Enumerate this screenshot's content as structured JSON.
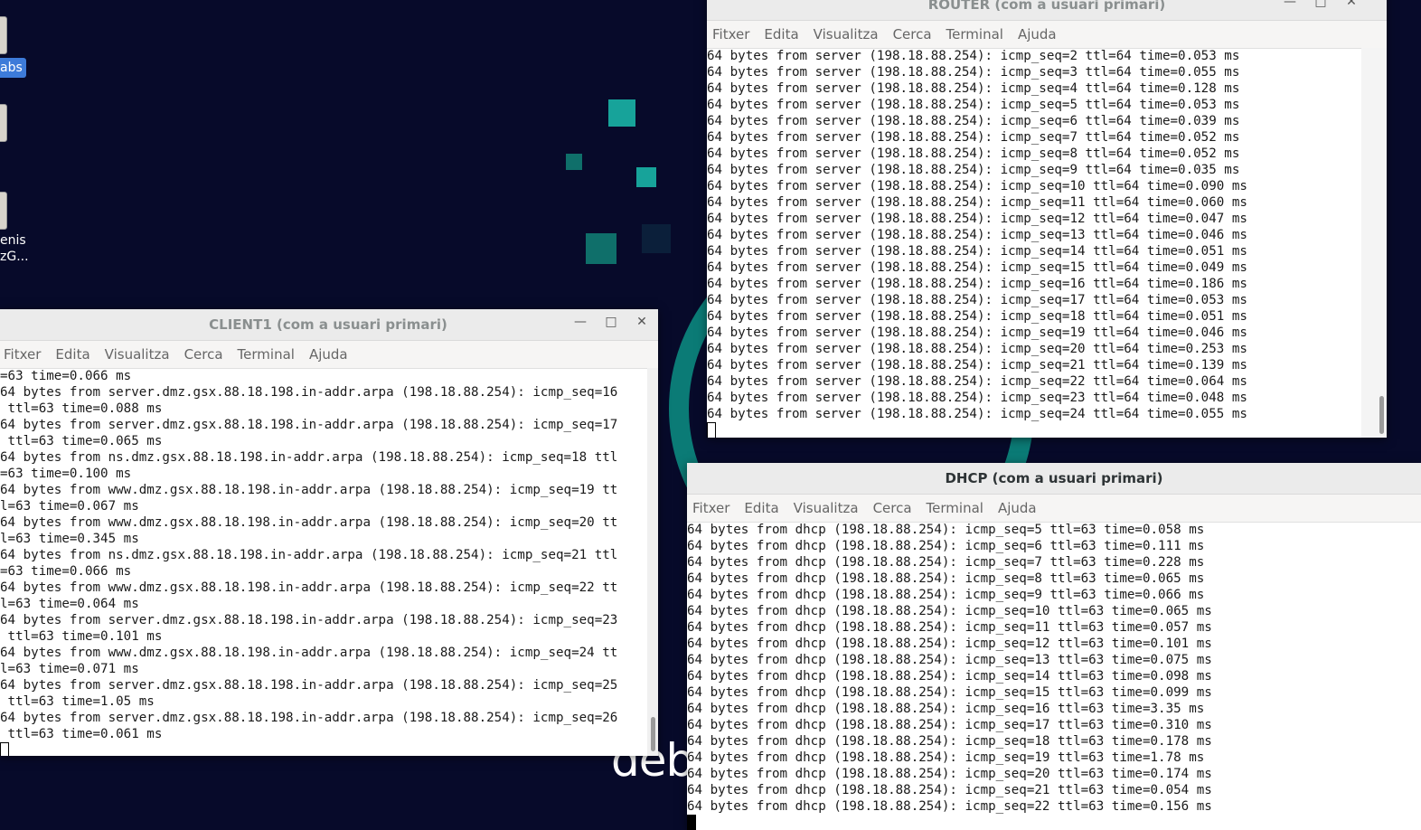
{
  "desktop": {
    "icon_labels": [
      "abs",
      "enis",
      "zG..."
    ],
    "logo": "debian"
  },
  "menu": [
    "Fitxer",
    "Edita",
    "Visualitza",
    "Cerca",
    "Terminal",
    "Ajuda"
  ],
  "router": {
    "title": "ROUTER (com a usuari primari)",
    "lines": [
      "64 bytes from server (198.18.88.254): icmp_seq=2 ttl=64 time=0.053 ms",
      "64 bytes from server (198.18.88.254): icmp_seq=3 ttl=64 time=0.055 ms",
      "64 bytes from server (198.18.88.254): icmp_seq=4 ttl=64 time=0.128 ms",
      "64 bytes from server (198.18.88.254): icmp_seq=5 ttl=64 time=0.053 ms",
      "64 bytes from server (198.18.88.254): icmp_seq=6 ttl=64 time=0.039 ms",
      "64 bytes from server (198.18.88.254): icmp_seq=7 ttl=64 time=0.052 ms",
      "64 bytes from server (198.18.88.254): icmp_seq=8 ttl=64 time=0.052 ms",
      "64 bytes from server (198.18.88.254): icmp_seq=9 ttl=64 time=0.035 ms",
      "64 bytes from server (198.18.88.254): icmp_seq=10 ttl=64 time=0.090 ms",
      "64 bytes from server (198.18.88.254): icmp_seq=11 ttl=64 time=0.060 ms",
      "64 bytes from server (198.18.88.254): icmp_seq=12 ttl=64 time=0.047 ms",
      "64 bytes from server (198.18.88.254): icmp_seq=13 ttl=64 time=0.046 ms",
      "64 bytes from server (198.18.88.254): icmp_seq=14 ttl=64 time=0.051 ms",
      "64 bytes from server (198.18.88.254): icmp_seq=15 ttl=64 time=0.049 ms",
      "64 bytes from server (198.18.88.254): icmp_seq=16 ttl=64 time=0.186 ms",
      "64 bytes from server (198.18.88.254): icmp_seq=17 ttl=64 time=0.053 ms",
      "64 bytes from server (198.18.88.254): icmp_seq=18 ttl=64 time=0.051 ms",
      "64 bytes from server (198.18.88.254): icmp_seq=19 ttl=64 time=0.046 ms",
      "64 bytes from server (198.18.88.254): icmp_seq=20 ttl=64 time=0.253 ms",
      "64 bytes from server (198.18.88.254): icmp_seq=21 ttl=64 time=0.139 ms",
      "64 bytes from server (198.18.88.254): icmp_seq=22 ttl=64 time=0.064 ms",
      "64 bytes from server (198.18.88.254): icmp_seq=23 ttl=64 time=0.048 ms",
      "64 bytes from server (198.18.88.254): icmp_seq=24 ttl=64 time=0.055 ms"
    ]
  },
  "client1": {
    "title": "CLIENT1 (com a usuari primari)",
    "lines": [
      "=63 time=0.066 ms",
      "64 bytes from server.dmz.gsx.88.18.198.in-addr.arpa (198.18.88.254): icmp_seq=16",
      " ttl=63 time=0.088 ms",
      "64 bytes from server.dmz.gsx.88.18.198.in-addr.arpa (198.18.88.254): icmp_seq=17",
      " ttl=63 time=0.065 ms",
      "64 bytes from ns.dmz.gsx.88.18.198.in-addr.arpa (198.18.88.254): icmp_seq=18 ttl",
      "=63 time=0.100 ms",
      "64 bytes from www.dmz.gsx.88.18.198.in-addr.arpa (198.18.88.254): icmp_seq=19 tt",
      "l=63 time=0.067 ms",
      "64 bytes from www.dmz.gsx.88.18.198.in-addr.arpa (198.18.88.254): icmp_seq=20 tt",
      "l=63 time=0.345 ms",
      "64 bytes from ns.dmz.gsx.88.18.198.in-addr.arpa (198.18.88.254): icmp_seq=21 ttl",
      "=63 time=0.066 ms",
      "64 bytes from www.dmz.gsx.88.18.198.in-addr.arpa (198.18.88.254): icmp_seq=22 tt",
      "l=63 time=0.064 ms",
      "64 bytes from server.dmz.gsx.88.18.198.in-addr.arpa (198.18.88.254): icmp_seq=23",
      " ttl=63 time=0.101 ms",
      "64 bytes from www.dmz.gsx.88.18.198.in-addr.arpa (198.18.88.254): icmp_seq=24 tt",
      "l=63 time=0.071 ms",
      "64 bytes from server.dmz.gsx.88.18.198.in-addr.arpa (198.18.88.254): icmp_seq=25",
      " ttl=63 time=1.05 ms",
      "64 bytes from server.dmz.gsx.88.18.198.in-addr.arpa (198.18.88.254): icmp_seq=26",
      " ttl=63 time=0.061 ms"
    ]
  },
  "dhcp": {
    "title": "DHCP (com a usuari primari)",
    "lines": [
      "64 bytes from dhcp (198.18.88.254): icmp_seq=5 ttl=63 time=0.058 ms",
      "64 bytes from dhcp (198.18.88.254): icmp_seq=6 ttl=63 time=0.111 ms",
      "64 bytes from dhcp (198.18.88.254): icmp_seq=7 ttl=63 time=0.228 ms",
      "64 bytes from dhcp (198.18.88.254): icmp_seq=8 ttl=63 time=0.065 ms",
      "64 bytes from dhcp (198.18.88.254): icmp_seq=9 ttl=63 time=0.066 ms",
      "64 bytes from dhcp (198.18.88.254): icmp_seq=10 ttl=63 time=0.065 ms",
      "64 bytes from dhcp (198.18.88.254): icmp_seq=11 ttl=63 time=0.057 ms",
      "64 bytes from dhcp (198.18.88.254): icmp_seq=12 ttl=63 time=0.101 ms",
      "64 bytes from dhcp (198.18.88.254): icmp_seq=13 ttl=63 time=0.075 ms",
      "64 bytes from dhcp (198.18.88.254): icmp_seq=14 ttl=63 time=0.098 ms",
      "64 bytes from dhcp (198.18.88.254): icmp_seq=15 ttl=63 time=0.099 ms",
      "64 bytes from dhcp (198.18.88.254): icmp_seq=16 ttl=63 time=3.35 ms",
      "64 bytes from dhcp (198.18.88.254): icmp_seq=17 ttl=63 time=0.310 ms",
      "64 bytes from dhcp (198.18.88.254): icmp_seq=18 ttl=63 time=0.178 ms",
      "64 bytes from dhcp (198.18.88.254): icmp_seq=19 ttl=63 time=1.78 ms",
      "64 bytes from dhcp (198.18.88.254): icmp_seq=20 ttl=63 time=0.174 ms",
      "64 bytes from dhcp (198.18.88.254): icmp_seq=21 ttl=63 time=0.054 ms",
      "64 bytes from dhcp (198.18.88.254): icmp_seq=22 ttl=63 time=0.156 ms"
    ]
  },
  "icons": {
    "minimize": "minimize-icon",
    "maximize": "maximize-icon",
    "close": "close-icon"
  }
}
